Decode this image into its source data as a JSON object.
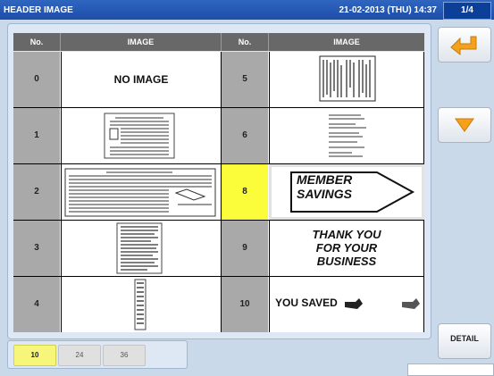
{
  "header": {
    "title": "HEADER IMAGE",
    "datetime": "21-02-2013 (THU) 14:37",
    "page": "1/4"
  },
  "table": {
    "col_no": "No.",
    "col_image": "IMAGE",
    "left": [
      {
        "no": "0",
        "image_text": "NO IMAGE"
      },
      {
        "no": "1"
      },
      {
        "no": "2"
      },
      {
        "no": "3"
      },
      {
        "no": "4"
      }
    ],
    "right": [
      {
        "no": "5"
      },
      {
        "no": "6"
      },
      {
        "no": "8",
        "selected": true,
        "image_text_line1": "MEMBER",
        "image_text_line2": "SAVINGS"
      },
      {
        "no": "9",
        "image_text_line1": "THANK YOU",
        "image_text_line2": "FOR YOUR",
        "image_text_line3": "BUSINESS"
      },
      {
        "no": "10",
        "image_text": "YOU SAVED"
      }
    ]
  },
  "sizes": {
    "options": [
      "10",
      "24",
      "36"
    ],
    "active": "10"
  },
  "buttons": {
    "detail": "DETAIL"
  },
  "colors": {
    "titlebar": "#1d4da8",
    "selected": "#fbfd3a",
    "header_cells": "#686868"
  }
}
